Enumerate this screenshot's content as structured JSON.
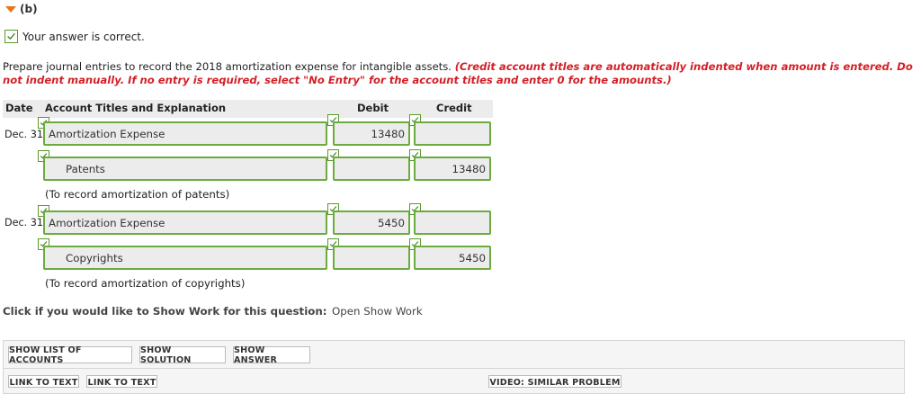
{
  "part": {
    "label": "(b)"
  },
  "status": {
    "message": "Your answer is correct."
  },
  "instructions": {
    "main": "Prepare journal entries to record the 2018 amortization expense for intangible assets.",
    "note": "(Credit account titles are automatically indented when amount is entered. Do not indent manually. If no entry is required, select \"No Entry\" for the account titles and enter 0 for the amounts.)"
  },
  "table": {
    "headers": {
      "date": "Date",
      "account": "Account Titles and Explanation",
      "debit": "Debit",
      "credit": "Credit"
    },
    "entries": [
      {
        "date": "Dec. 31",
        "debit_line": {
          "account": "Amortization Expense",
          "debit": "13480",
          "credit": ""
        },
        "credit_line": {
          "account": "Patents",
          "debit": "",
          "credit": "13480"
        },
        "explanation": "(To record amortization of patents)"
      },
      {
        "date": "Dec. 31",
        "debit_line": {
          "account": "Amortization Expense",
          "debit": "5450",
          "credit": ""
        },
        "credit_line": {
          "account": "Copyrights",
          "debit": "",
          "credit": "5450"
        },
        "explanation": "(To record amortization of copyrights)"
      }
    ]
  },
  "show_work": {
    "prompt": "Click if you would like to Show Work for this question:",
    "link": "Open Show Work"
  },
  "toolbar": {
    "show_list": "SHOW LIST OF ACCOUNTS",
    "show_solution": "SHOW SOLUTION",
    "show_answer": "SHOW ANSWER",
    "link_text_1": "LINK TO TEXT",
    "link_text_2": "LINK TO TEXT",
    "video": "VIDEO: SIMILAR PROBLEM"
  },
  "colors": {
    "accent": "#e8731c",
    "correct_border": "#6bab3f",
    "alert_red": "#d31f26"
  }
}
